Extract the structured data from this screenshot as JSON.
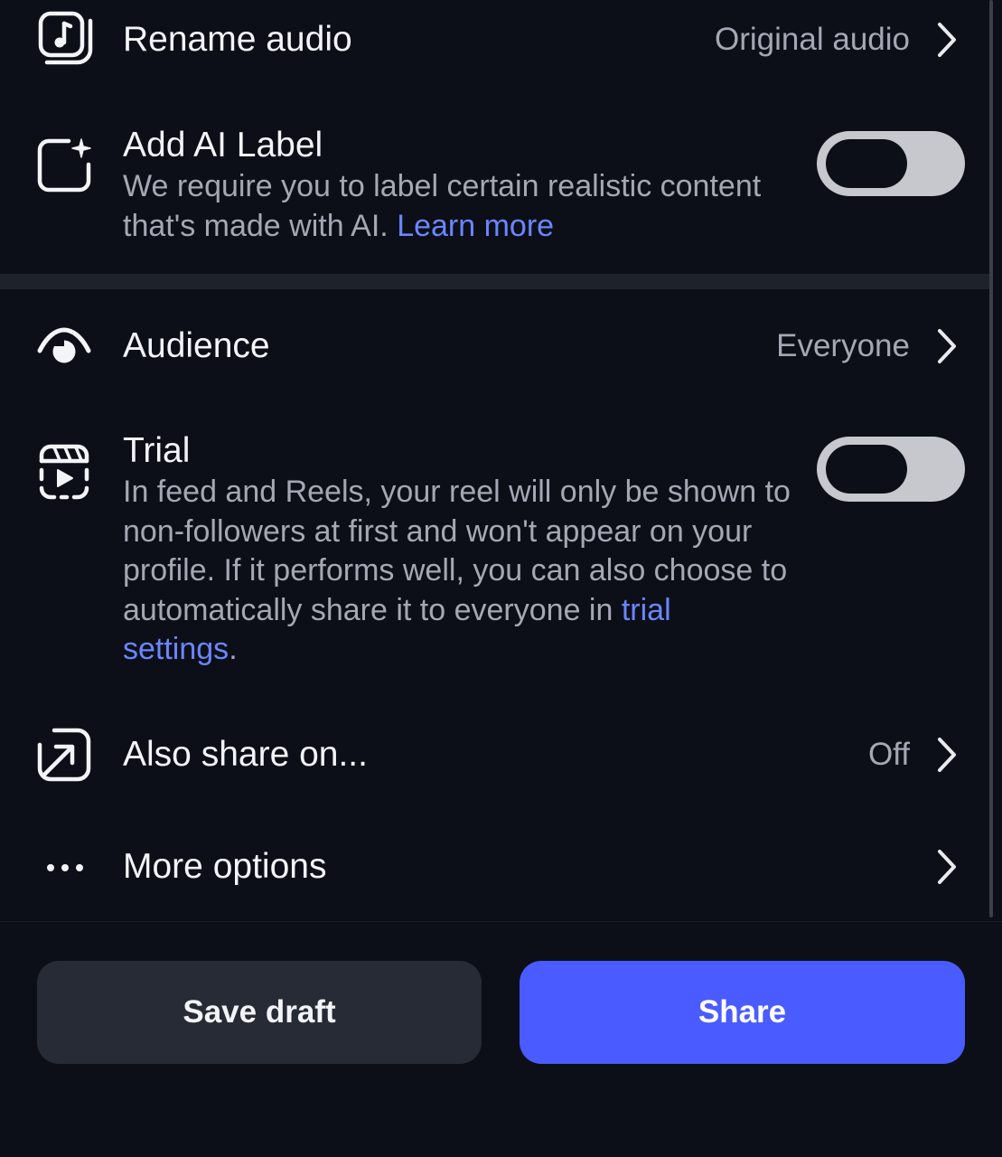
{
  "rename_audio": {
    "title": "Rename audio",
    "value": "Original audio",
    "icon": "audio-note-icon"
  },
  "ai_label": {
    "title": "Add AI Label",
    "description": "We require you to label certain realistic content that's made with AI.",
    "link": "Learn more",
    "enabled": false,
    "icon": "ai-label-icon"
  },
  "audience": {
    "title": "Audience",
    "value": "Everyone",
    "icon": "eye-icon"
  },
  "trial": {
    "title": "Trial",
    "description": "In feed and Reels, your reel will only be shown to non-followers at first and won't appear on your profile. If it performs well, you can also choose to automatically share it to everyone in",
    "link": "trial settings",
    "description_end": ".",
    "enabled": false,
    "icon": "trial-reel-icon"
  },
  "also_share": {
    "title": "Also share on...",
    "value": "Off",
    "icon": "share-arrow-icon"
  },
  "more_options": {
    "title": "More options",
    "icon": "more-dots-icon"
  },
  "buttons": {
    "save_draft": "Save draft",
    "share": "Share"
  },
  "colors": {
    "background": "#0c0f17",
    "link": "#6a86ff",
    "share_button": "#4a5bff",
    "save_button": "#272b35",
    "toggle_track": "#c6c8ce"
  }
}
